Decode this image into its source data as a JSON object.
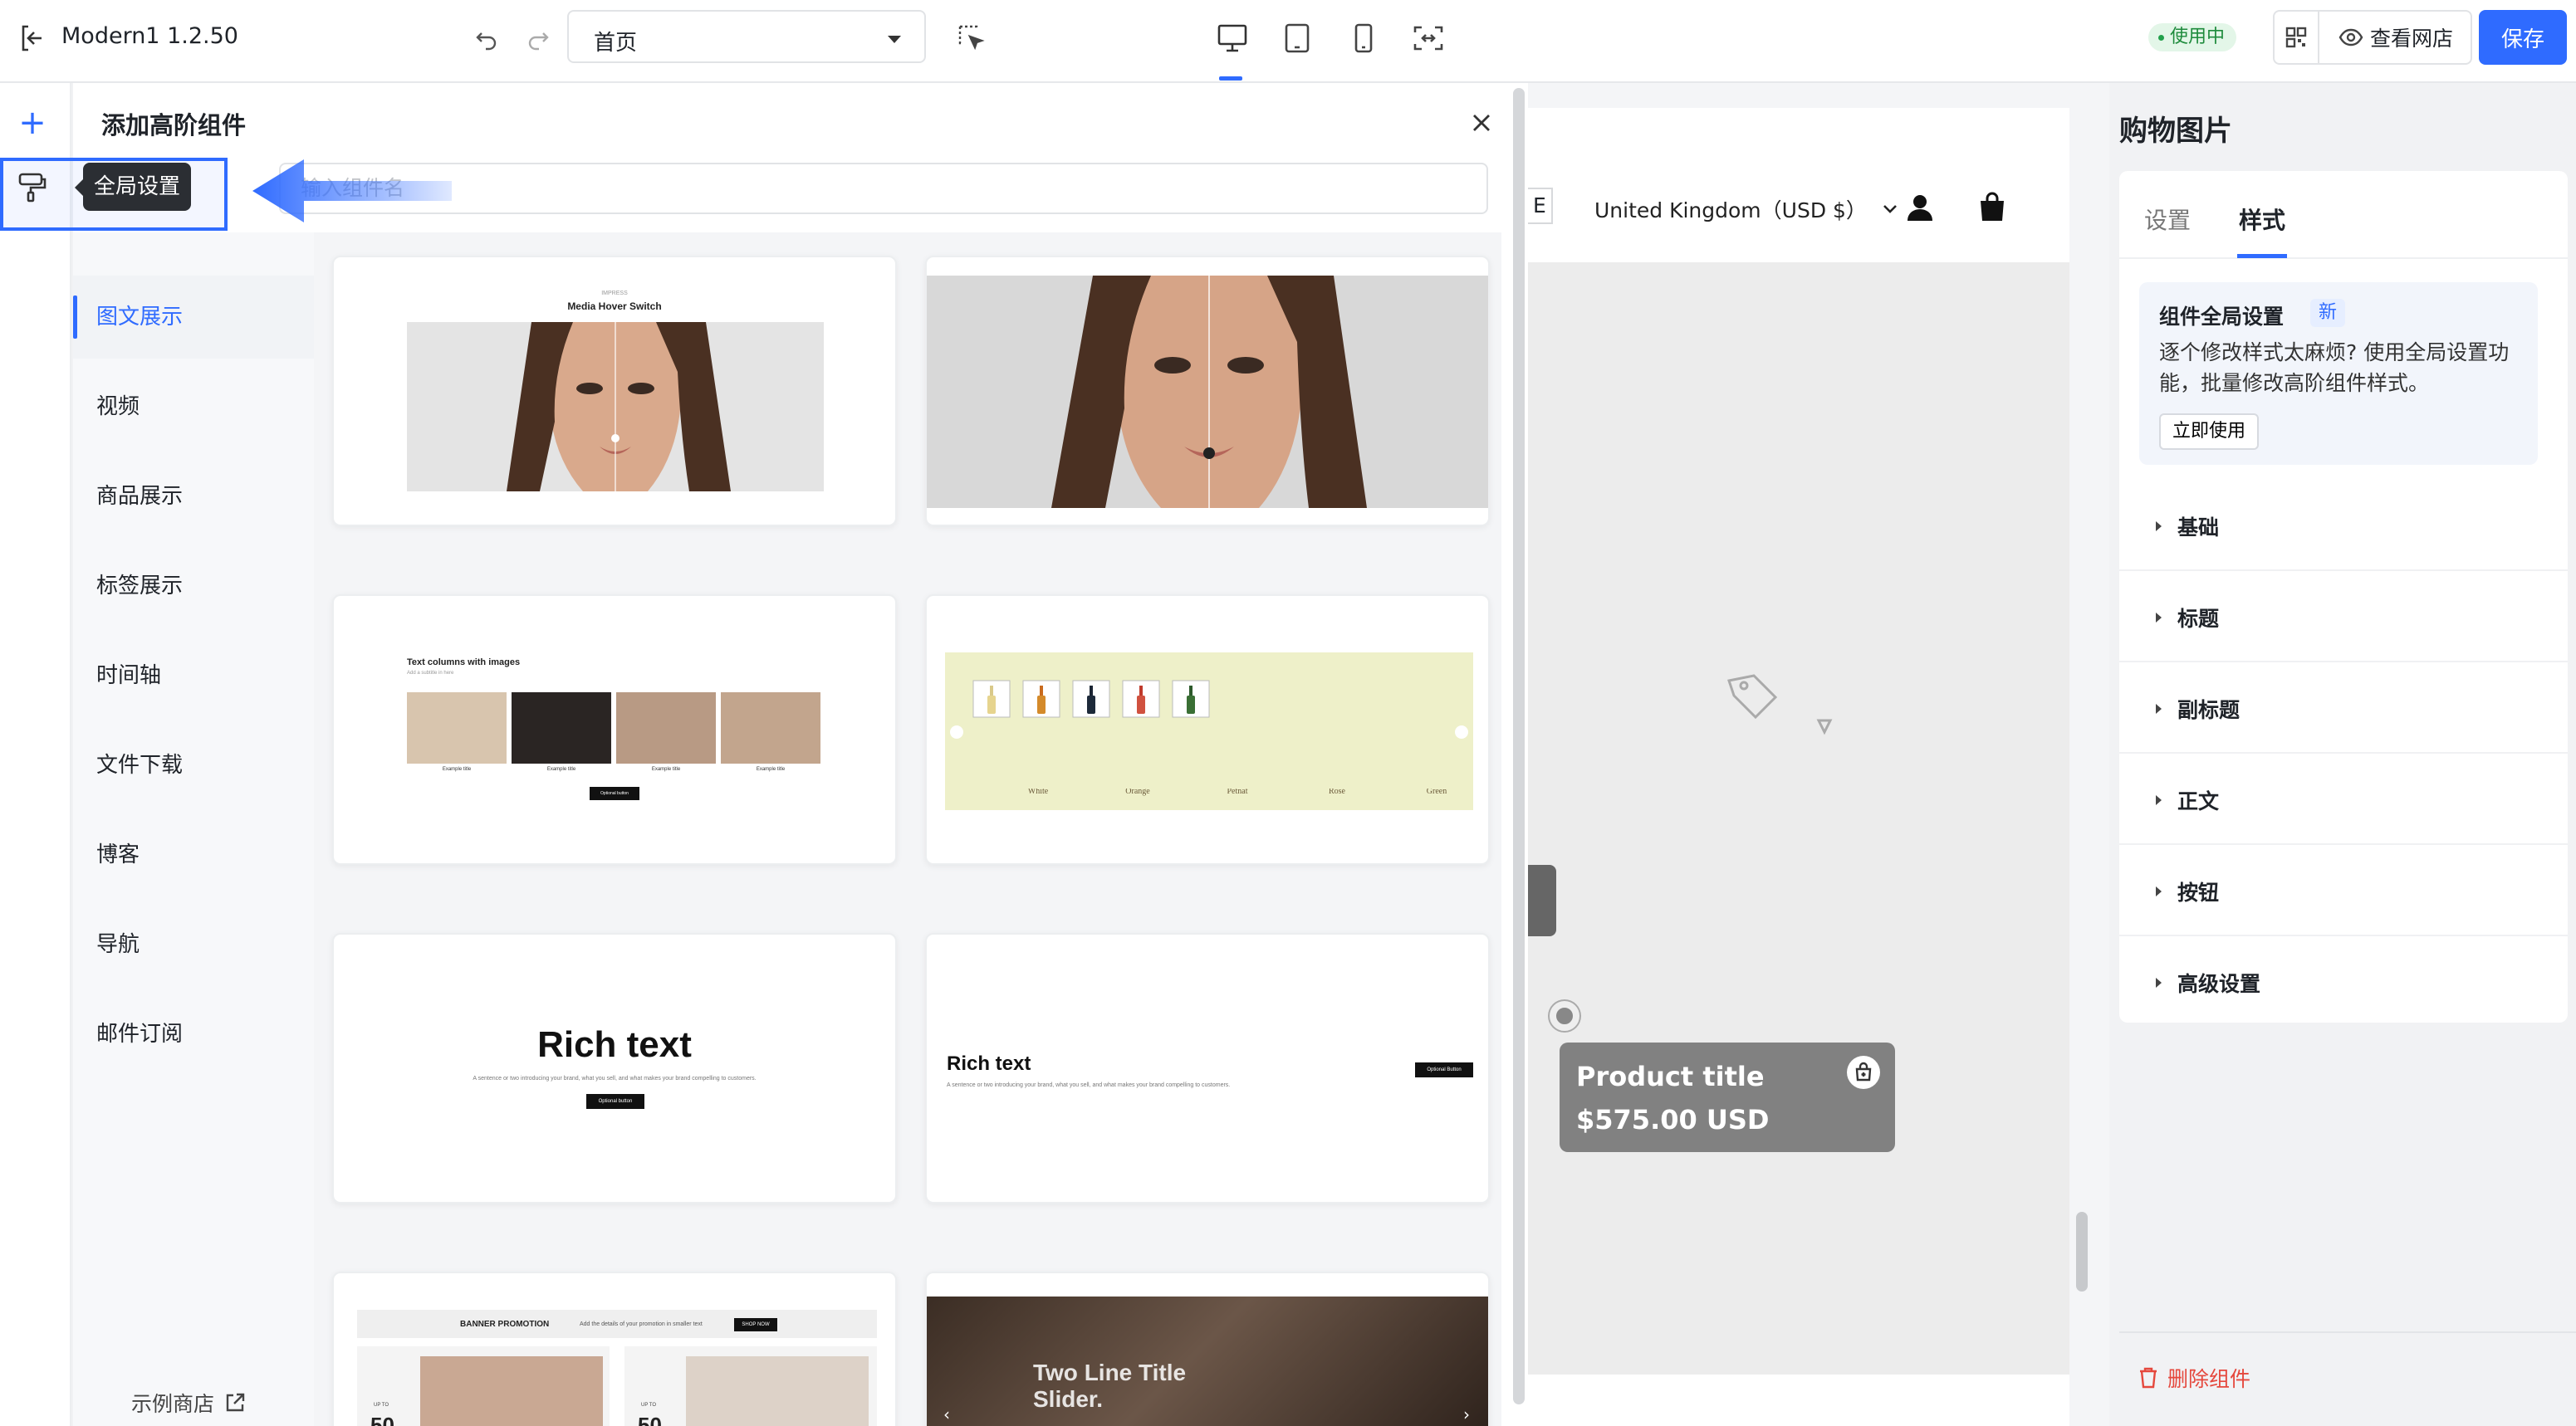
{
  "app": {
    "title": "Modern1 1.2.50",
    "page_select": "首页",
    "status": "使用中",
    "view_store": "查看网店",
    "save": "保存"
  },
  "rail": {
    "tooltip": "全局设置"
  },
  "panel": {
    "title": "添加高阶组件",
    "search_placeholder": "输入组件名",
    "categories": [
      "图文展示",
      "视频",
      "商品展示",
      "标签展示",
      "时间轴",
      "文件下载",
      "博客",
      "导航",
      "邮件订阅"
    ],
    "example_store": "示例商店",
    "previews": {
      "media_hover_small": "IMPRESS",
      "media_hover_title": "Media Hover Switch",
      "text_columns_title": "Text columns with images",
      "text_columns_sub": "Add a subtitle in here",
      "example_title": "Example title",
      "optional_button": "Optional button",
      "wines": [
        "White",
        "Orange",
        "Petnat",
        "Rosé",
        "Green"
      ],
      "rich_text_title": "Rich text",
      "rich_text_desc": "A sentence or two introducing your brand, what you sell, and what makes your brand compelling to customers.",
      "optional_button_2": "Optional Button",
      "banner_title": "BANNER PROMOTION",
      "banner_desc": "Add the details of your promotion in smaller text",
      "banner_cta": "SHOP NOW",
      "up_to": "UP TO",
      "fifty": "50",
      "slider_title_1": "Two Line Title",
      "slider_title_2": "Slider."
    }
  },
  "canvas": {
    "edge_letter": "E",
    "region": "United Kingdom（USD $）",
    "product_title": "Product title",
    "product_price": "$575.00 USD"
  },
  "right": {
    "title": "购物图片",
    "tabs": [
      "设置",
      "样式"
    ],
    "notice_title": "组件全局设置",
    "notice_badge": "新",
    "notice_text": "逐个修改样式太麻烦? 使用全局设置功能，批量修改高阶组件样式。",
    "notice_btn": "立即使用",
    "sections": [
      "基础",
      "标题",
      "副标题",
      "正文",
      "按钮",
      "高级设置"
    ],
    "delete": "删除组件"
  },
  "colors": {
    "accent": "#2f6bff",
    "danger": "#e5483d",
    "live": "#1e8b3c"
  }
}
